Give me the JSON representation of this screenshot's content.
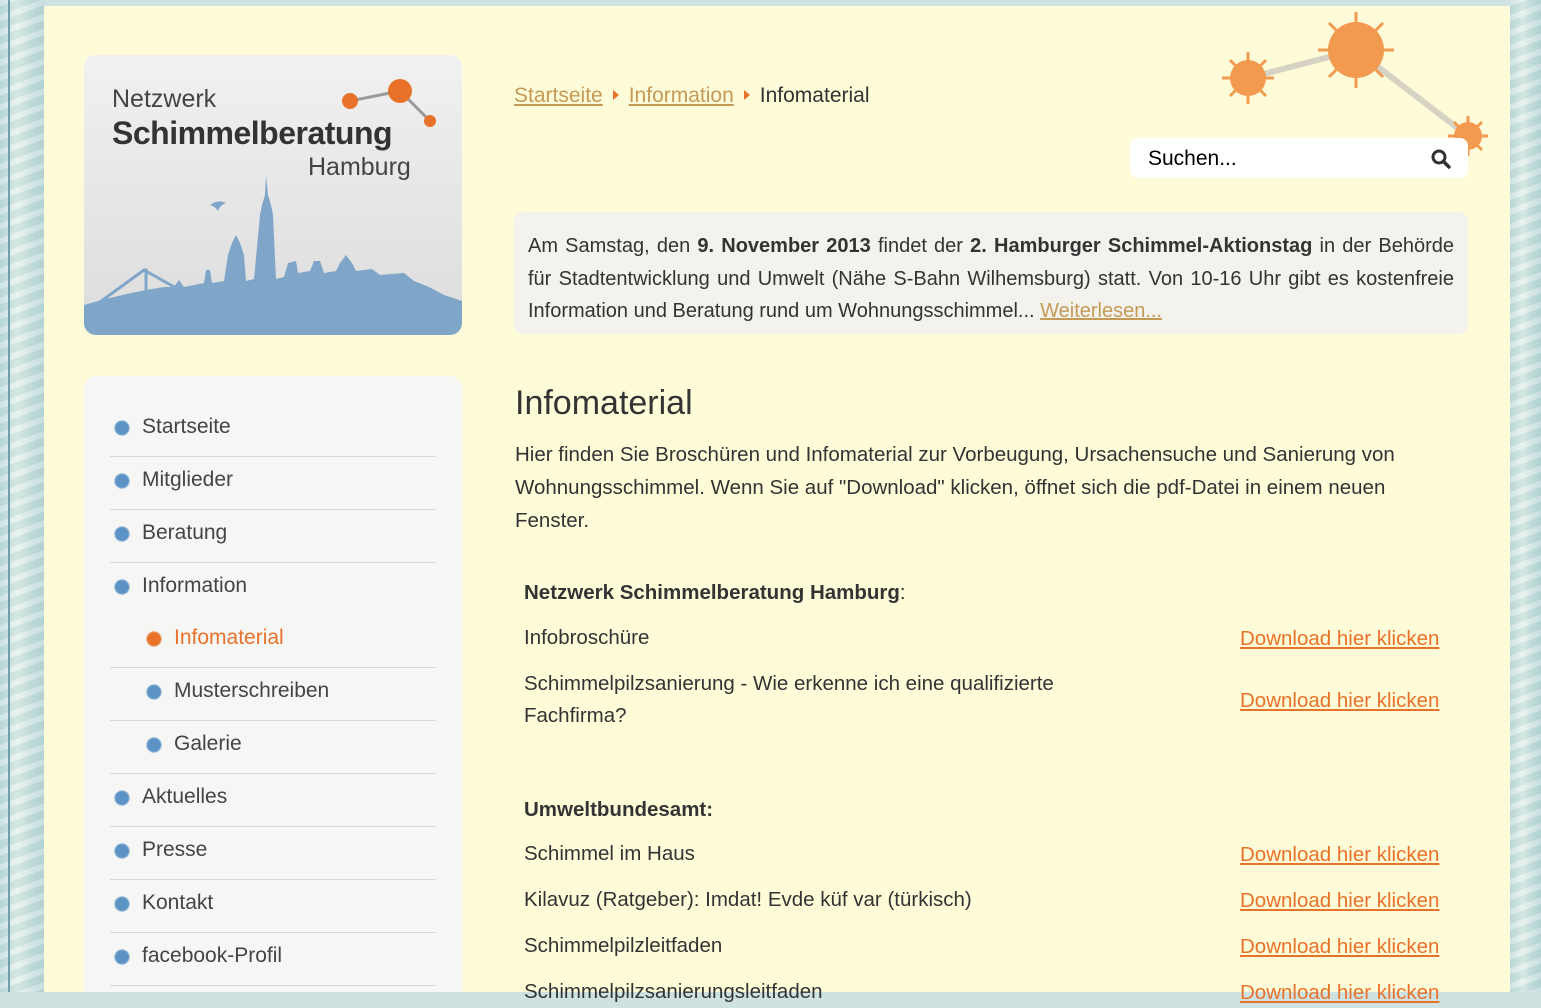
{
  "logo": {
    "line1": "Netzwerk",
    "line2": "Schimmelberatung",
    "line3": "Hamburg"
  },
  "breadcrumb": {
    "home": "Startseite",
    "section": "Information",
    "current": "Infomaterial"
  },
  "search": {
    "placeholder": "Suchen..."
  },
  "notice": {
    "t1": "Am Samstag, den ",
    "b1": "9. November 2013",
    "t2": " findet der ",
    "b2": "2. Hamburger Schimmel-Aktionstag",
    "t3": " in der Behörde für Stadtentwicklung und Umwelt (Nähe S-Bahn Wilhemsburg) statt. Von 10-16 Uhr gibt es kostenfreie Information und Beratung rund um Wohnungsschimmel... ",
    "link": "Weiterlesen..."
  },
  "nav": {
    "startseite": "Startseite",
    "mitglieder": "Mitglieder",
    "beratung": "Beratung",
    "information": "Information",
    "infomaterial": "Infomaterial",
    "musterschreiben": "Musterschreiben",
    "galerie": "Galerie",
    "aktuelles": "Aktuelles",
    "presse": "Presse",
    "kontakt": "Kontakt",
    "facebook": "facebook-Profil"
  },
  "content": {
    "title": "Infomaterial",
    "intro": "Hier finden Sie Broschüren und Infomaterial zur Vorbeugung, Ursachensuche und Sanierung von Wohnungsschimmel. Wenn Sie auf \"Download\" klicken, öffnet sich die pdf-Datei in einem neuen Fenster.",
    "download_label": "Download hier klicken",
    "section1": {
      "title": "Netzwerk Schimmelberatung Hamburg",
      "colon": ":"
    },
    "item1": "Infobroschüre",
    "item2": "Schimmelpilzsanierung - Wie erkenne ich eine qualifizierte Fachfirma?",
    "section2": {
      "title": "Umweltbundesamt:"
    },
    "item3": "Schimmel im Haus",
    "item4": "Kilavuz (Ratgeber): Imdat! Evde küf var (türkisch)",
    "item5": "Schimmelpilzleitfaden",
    "item6": "Schimmelpilzsanierungsleitfaden"
  },
  "colors": {
    "accent": "#e8722a",
    "link_muted": "#c59a57",
    "nav_dot": "#5b93c5",
    "page_bg": "#fefbd9"
  }
}
